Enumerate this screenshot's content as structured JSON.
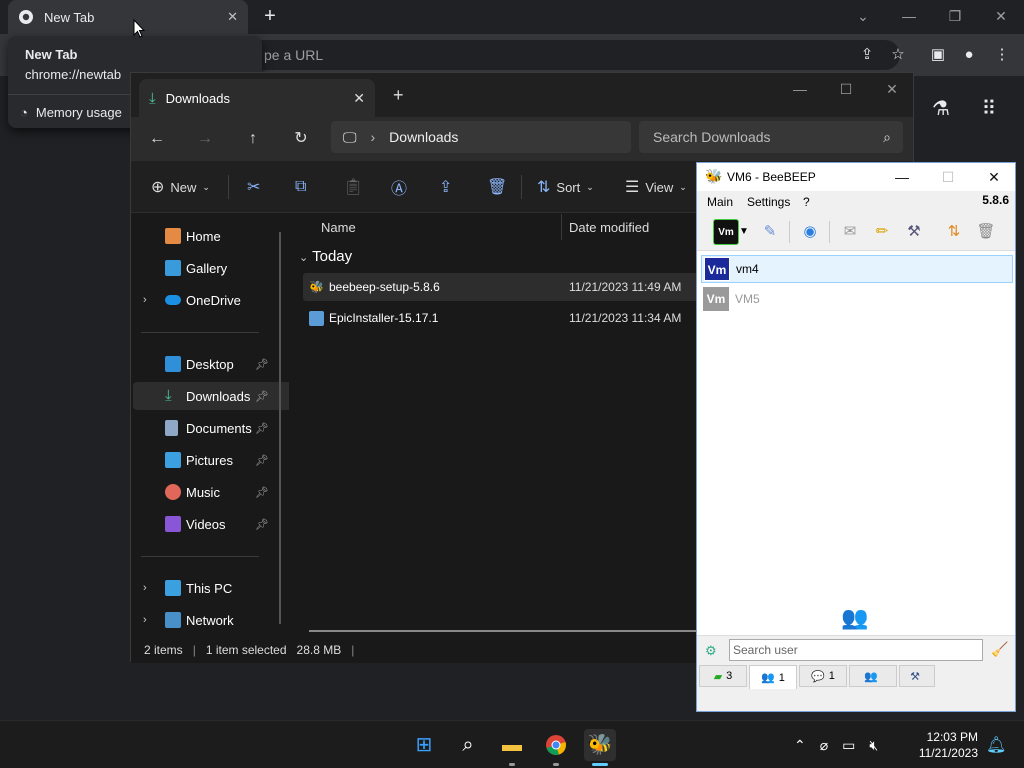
{
  "chrome": {
    "tab_title": "New Tab",
    "tab_close": "✕",
    "new_tab": "+",
    "omnibox_placeholder": "pe a URL",
    "hover_card": {
      "title": "New Tab",
      "url": "chrome://newtab",
      "memory": "Memory usage"
    }
  },
  "explorer": {
    "tab_title": "Downloads",
    "tab_close": "✕",
    "new_tab": "+",
    "address_location": "Downloads",
    "search_placeholder": "Search Downloads",
    "commands": {
      "new": "New",
      "sort": "Sort",
      "view": "View"
    },
    "nav": {
      "home": "Home",
      "gallery": "Gallery",
      "onedrive": "OneDrive",
      "desktop": "Desktop",
      "downloads": "Downloads",
      "documents": "Documents",
      "pictures": "Pictures",
      "music": "Music",
      "videos": "Videos",
      "this_pc": "This PC",
      "network": "Network"
    },
    "columns": {
      "name": "Name",
      "date_modified": "Date modified"
    },
    "group": "Today",
    "files": [
      {
        "name": "beebeep-setup-5.8.6",
        "date": "11/21/2023 11:49 AM"
      },
      {
        "name": "EpicInstaller-15.17.1",
        "date": "11/21/2023 11:34 AM"
      }
    ],
    "status": {
      "items": "2 items",
      "selected": "1 item selected",
      "size": "28.8 MB"
    }
  },
  "beebeep": {
    "title": "VM6 - BeeBEEP",
    "menu": {
      "main": "Main",
      "settings": "Settings",
      "help": "?"
    },
    "version": "5.8.6",
    "users": [
      {
        "avatar": "Vm",
        "name": "vm4"
      },
      {
        "avatar": "Vm",
        "name": "VM5"
      }
    ],
    "search_placeholder": "Search user",
    "tabs": [
      {
        "count": "3"
      },
      {
        "count": "1"
      },
      {
        "count": "1"
      },
      {
        "count": ""
      },
      {
        "count": ""
      }
    ]
  },
  "taskbar": {
    "time": "12:03 PM",
    "date": "11/21/2023"
  },
  "colors": {
    "chrome_bg": "#202124",
    "explorer_bg": "#191919",
    "accent": "#60cdff",
    "selected_user": "#e5f3ff"
  }
}
